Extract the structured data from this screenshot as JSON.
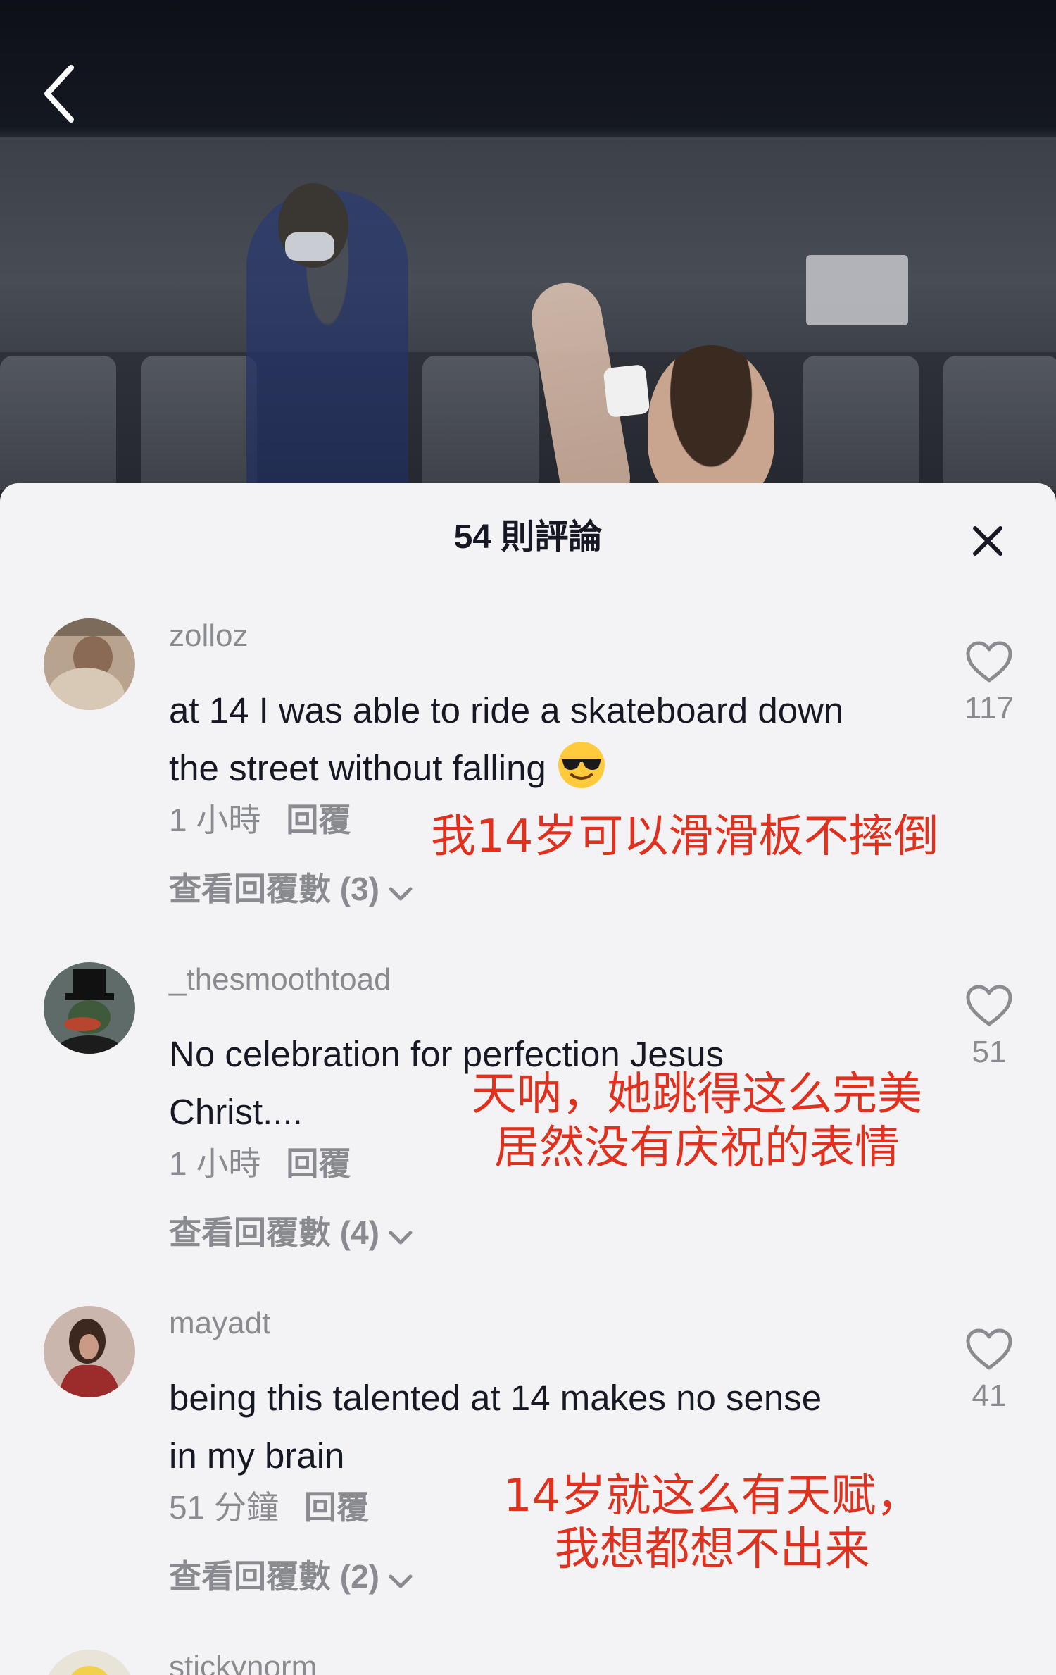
{
  "header": {
    "back_icon": "chevron-left-icon"
  },
  "comments_sheet": {
    "title": "54 則評論",
    "close_icon": "close-icon",
    "comments": [
      {
        "username": "zolloz",
        "text": "at 14 I was able to ride a skateboard down the street without falling",
        "emoji": "sunglasses-face-emoji",
        "time": "1 小時",
        "reply_label": "回覆",
        "view_replies": "查看回覆數 (3)",
        "like_count": "117",
        "annotation": [
          "我14岁可以滑滑板不摔倒"
        ]
      },
      {
        "username": "_thesmoothtoad",
        "text": "No celebration for perfection Jesus Christ....",
        "time": "1 小時",
        "reply_label": "回覆",
        "view_replies": "查看回覆數 (4)",
        "like_count": "51",
        "annotation": [
          "天呐，她跳得这么完美",
          "居然没有庆祝的表情"
        ]
      },
      {
        "username": "mayadt",
        "text": "being this talented at 14 makes no sense in my brain",
        "time": "51 分鐘",
        "reply_label": "回覆",
        "view_replies": "查看回覆數 (2)",
        "like_count": "41",
        "annotation": [
          "14岁就这么有天赋，",
          "我想都想不出来"
        ]
      },
      {
        "username": "stickynorm"
      }
    ]
  },
  "colors": {
    "annotation_red": "#e0301e",
    "text_primary": "#161823",
    "text_secondary": "#8a8b91",
    "sheet_bg": "#f3f3f5"
  }
}
